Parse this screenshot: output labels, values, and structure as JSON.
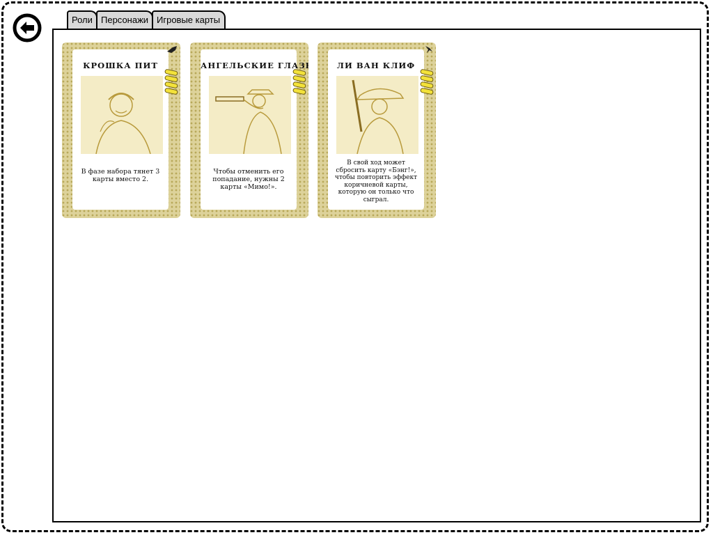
{
  "tabs": [
    {
      "label": "Роли"
    },
    {
      "label": "Персонажи"
    },
    {
      "label": "Игровые карты"
    }
  ],
  "cards": [
    {
      "title": "КРОШКА ПИТ",
      "text": "В фазе набора тянет 3 карты вместо 2.",
      "lives": 4
    },
    {
      "title": "АНГЕЛЬСКИЕ ГЛАЗКИ",
      "text": "Чтобы отменить его попадание, нужны 2 карты «Мимо!».",
      "lives": 4
    },
    {
      "title": "ЛИ ВАН КЛИФ",
      "text": "В свой ход может сбросить карту «Бэнг!», чтобы повторить эффект коричневой карты, которую он только что сыграл.",
      "lives": 4
    }
  ],
  "icons": {
    "back": "arrow-left-circle-icon",
    "lives": "bullet-icon"
  },
  "colors": {
    "card_border": "#ddd29a",
    "art_tint": "#f4ecc6",
    "bullet": "#f3e23a",
    "tab_bg": "#d9d9d9"
  }
}
